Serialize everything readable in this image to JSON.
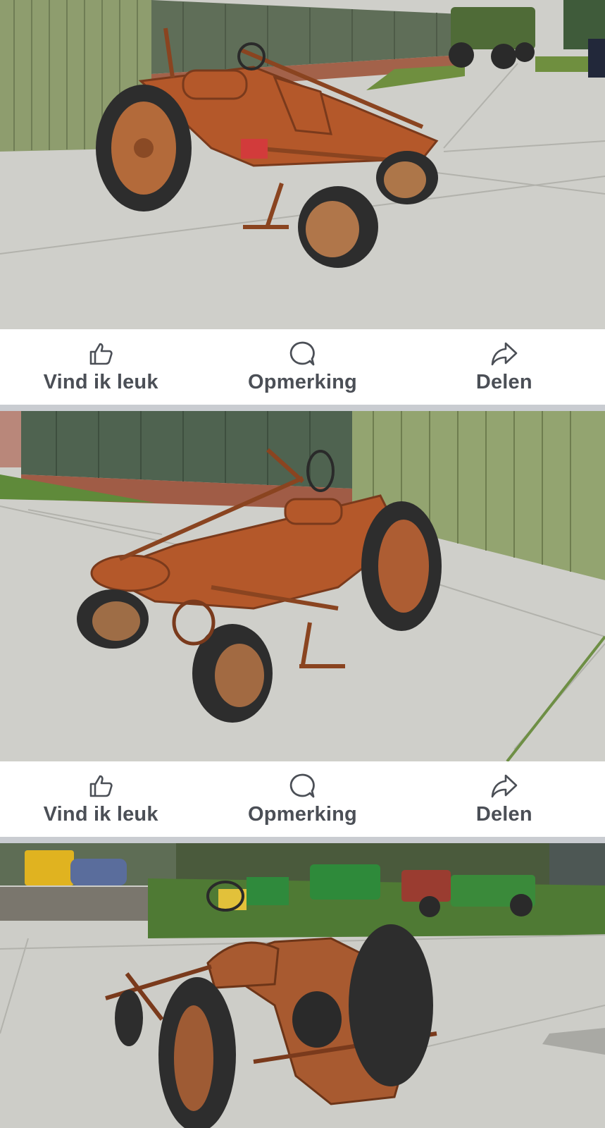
{
  "feed": {
    "actions": [
      {
        "label": "Vind ik leuk",
        "icon": "thumbs-up-icon"
      },
      {
        "label": "Opmerking",
        "icon": "comment-icon"
      },
      {
        "label": "Delen",
        "icon": "share-icon"
      }
    ]
  },
  "colors": {
    "action_text": "#4b4f56",
    "separator": "#c9ccd1",
    "bar_background": "#ffffff"
  }
}
